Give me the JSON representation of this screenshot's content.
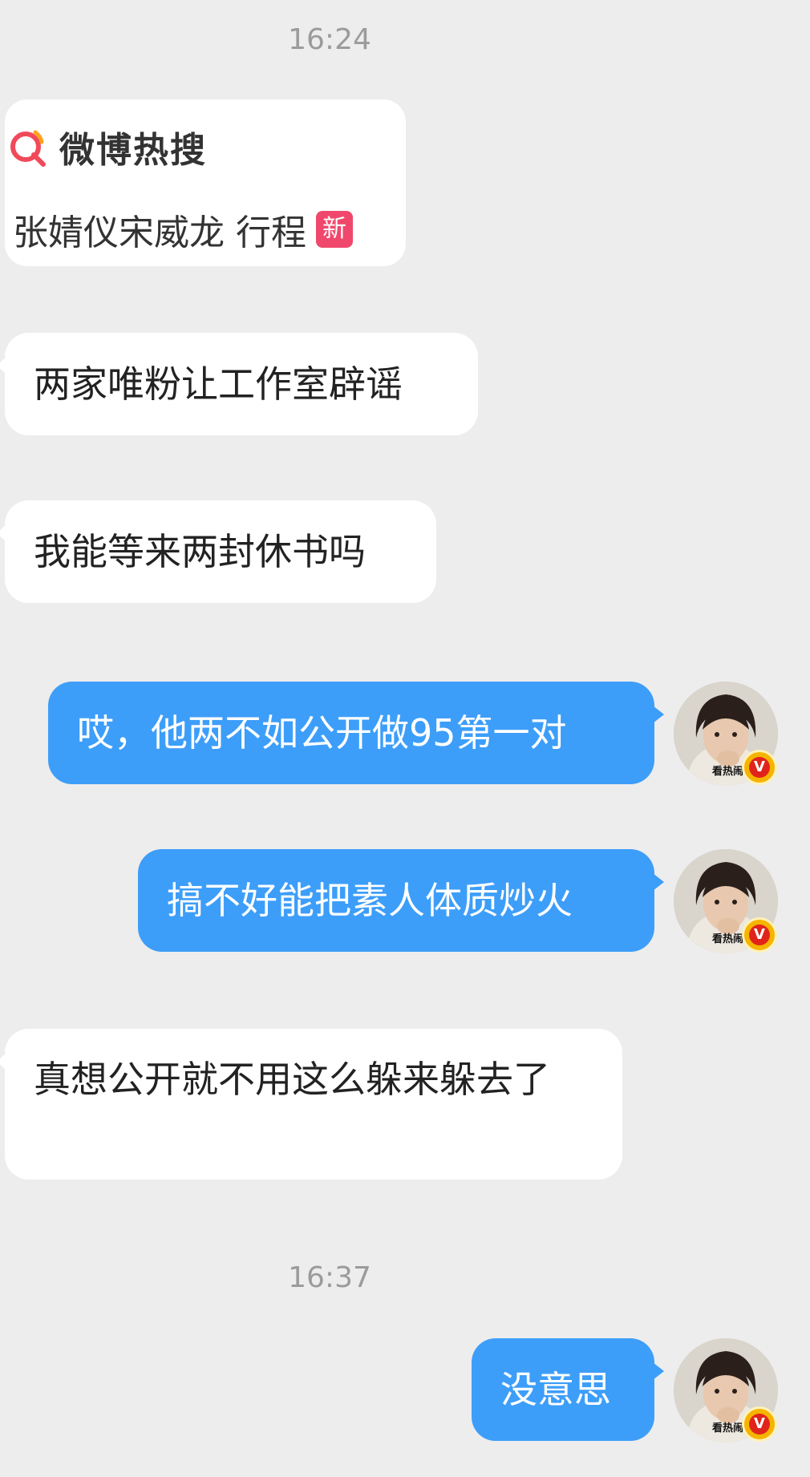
{
  "timestamps": [
    "16:24",
    "16:37"
  ],
  "share_card": {
    "brand": "微博热搜",
    "topic": "张婧仪宋威龙 行程",
    "badge": "新"
  },
  "messages": [
    {
      "side": "in",
      "text": "两家唯粉让工作室辟谣"
    },
    {
      "side": "in",
      "text": "我能等来两封休书吗"
    },
    {
      "side": "out",
      "text": "哎，他两不如公开做95第一对"
    },
    {
      "side": "out",
      "text": "搞不好能把素人体质炒火"
    },
    {
      "side": "in",
      "text": "真想公开就不用这么躲来躲去了"
    },
    {
      "side": "out",
      "text": "没意思"
    }
  ],
  "avatar": {
    "caption": "看热闹",
    "badge_letter": "V",
    "icon": "user-avatar-icon"
  },
  "colors": {
    "background": "#ededed",
    "incoming_bubble": "#ffffff",
    "outgoing_bubble": "#3d9ef9",
    "timestamp_text": "#9b9b9b",
    "new_badge": "#f0486c",
    "verified_badge": "#f5b400"
  }
}
